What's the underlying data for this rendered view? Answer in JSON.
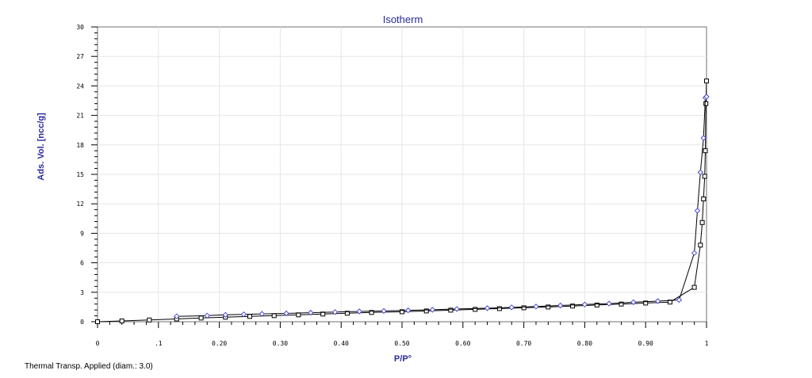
{
  "window": {
    "footnote": "Thermal Transp. Applied (diam.: 3.0)"
  },
  "chart_data": {
    "type": "scatter",
    "title": "Isotherm",
    "xlabel": "P/P°",
    "ylabel": "Ads. Vol. [ncc/g]",
    "xlim": [
      0,
      1
    ],
    "ylim": [
      0,
      30
    ],
    "x_ticks": [
      {
        "value": 0,
        "label": "0"
      },
      {
        "value": 0.1,
        "label": ".1"
      },
      {
        "value": 0.2,
        "label": "0.20"
      },
      {
        "value": 0.3,
        "label": "0.30"
      },
      {
        "value": 0.4,
        "label": "0.40"
      },
      {
        "value": 0.5,
        "label": "0.50"
      },
      {
        "value": 0.6,
        "label": "0.60"
      },
      {
        "value": 0.7,
        "label": "0.70"
      },
      {
        "value": 0.8,
        "label": "0.80"
      },
      {
        "value": 0.9,
        "label": "0.90"
      },
      {
        "value": 1.0,
        "label": "1"
      }
    ],
    "y_ticks": [
      {
        "value": 0,
        "label": "0"
      },
      {
        "value": 3,
        "label": "3"
      },
      {
        "value": 6,
        "label": "6"
      },
      {
        "value": 9,
        "label": "9"
      },
      {
        "value": 12,
        "label": "12"
      },
      {
        "value": 15,
        "label": "15"
      },
      {
        "value": 18,
        "label": "18"
      },
      {
        "value": 21,
        "label": "21"
      },
      {
        "value": 24,
        "label": "24"
      },
      {
        "value": 27,
        "label": "27"
      },
      {
        "value": 30,
        "label": "30"
      }
    ],
    "grid": true,
    "colors": {
      "title": "#2a2a9a",
      "adsorption": "#4a4ac8",
      "desorption": "#000000",
      "line": "#000000",
      "grid": "#e6e6e6"
    },
    "series": [
      {
        "marker": "square",
        "x": [
          0.0,
          0.04,
          0.085,
          0.13,
          0.17,
          0.21,
          0.25,
          0.29,
          0.33,
          0.37,
          0.41,
          0.45,
          0.5,
          0.54,
          0.58,
          0.62,
          0.66,
          0.7,
          0.74,
          0.78,
          0.82,
          0.86,
          0.9,
          0.94,
          0.98,
          0.99,
          0.993,
          0.995,
          0.997,
          0.998,
          0.999,
          1.0
        ],
        "y": [
          0.0,
          0.08,
          0.18,
          0.28,
          0.38,
          0.46,
          0.54,
          0.62,
          0.7,
          0.78,
          0.86,
          0.94,
          1.02,
          1.1,
          1.18,
          1.26,
          1.34,
          1.42,
          1.5,
          1.6,
          1.7,
          1.8,
          1.9,
          2.0,
          3.5,
          7.8,
          10.1,
          12.5,
          14.8,
          17.4,
          22.2,
          24.5
        ]
      },
      {
        "marker": "diamond",
        "x": [
          0.13,
          0.18,
          0.21,
          0.24,
          0.27,
          0.31,
          0.35,
          0.39,
          0.43,
          0.47,
          0.51,
          0.55,
          0.59,
          0.64,
          0.68,
          0.72,
          0.76,
          0.8,
          0.84,
          0.88,
          0.92,
          0.955,
          0.98,
          0.985,
          0.99,
          0.995,
          0.998,
          1.0
        ],
        "y": [
          0.55,
          0.62,
          0.7,
          0.75,
          0.8,
          0.85,
          0.92,
          0.98,
          1.05,
          1.1,
          1.16,
          1.22,
          1.3,
          1.38,
          1.46,
          1.55,
          1.65,
          1.75,
          1.85,
          1.98,
          2.1,
          2.22,
          7.0,
          11.3,
          15.2,
          18.7,
          22.8,
          22.9
        ]
      }
    ]
  }
}
